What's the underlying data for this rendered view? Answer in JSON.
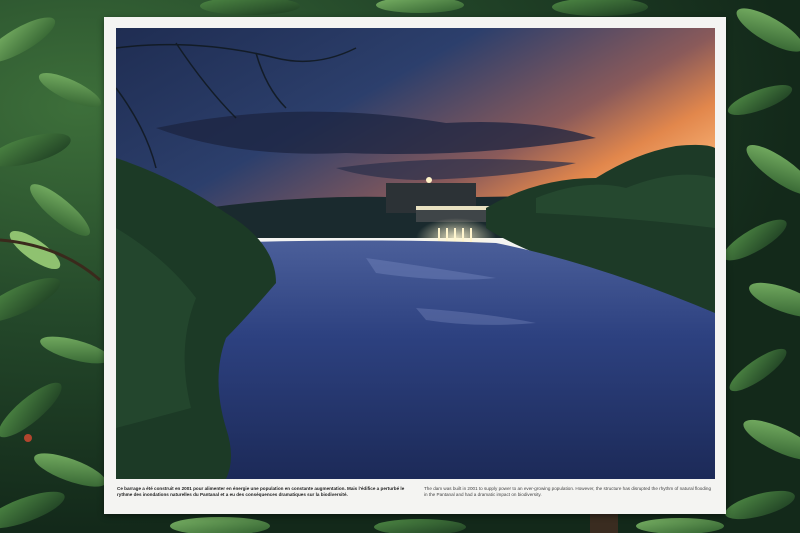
{
  "sign": {
    "caption_fr": "Ce barrage a été construit en 2001 pour alimenter en énergie une population en constante augmentation. Mais l'édifice a perturbé le rythme des inondations naturelles du Pantanal et a eu des conséquences dramatiques sur la biodiversité.",
    "caption_en": "The dam was built in 2001 to supply power to an ever-growing population. However, the structure has disrupted the rhythm of natural flooding in the Pantanal and had a dramatic impact on biodiversity."
  },
  "colors": {
    "panel": "#f4f4f2",
    "foliage_light": "#5f9a4e",
    "foliage_dark": "#1d3d22",
    "sky_top": "#26385e",
    "sunset": "#e8844a",
    "water": "#2a3f7a",
    "dam_lights": "#fff3c8"
  }
}
